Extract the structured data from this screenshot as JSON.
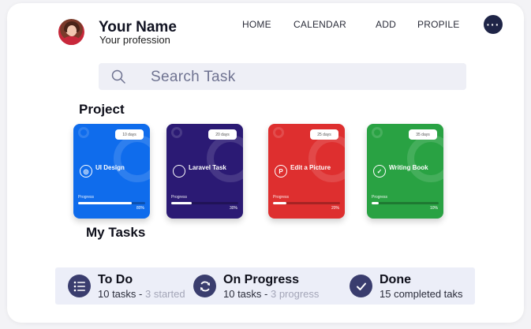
{
  "profile": {
    "name": "Your Name",
    "profession": "Your profession"
  },
  "nav": {
    "home": "HOME",
    "calendar": "CALENDAR",
    "add": "ADD",
    "profile": "PROPILE",
    "more_icon": "ellipsis-icon"
  },
  "search": {
    "placeholder": "Search Task"
  },
  "sections": {
    "project": "Project",
    "my_tasks": "My Tasks"
  },
  "projects": [
    {
      "name": "UI Design",
      "days": "10 days",
      "progress_label": "Progress",
      "progress": 0.8,
      "percent": "80%",
      "color": "#0f6cec",
      "icon": "ui-design-icon"
    },
    {
      "name": "Laravel Task",
      "days": "20 days",
      "progress_label": "Progress",
      "progress": 0.3,
      "percent": "30%",
      "color": "#2b1a74",
      "icon": "code-icon"
    },
    {
      "name": "Edit a Picture",
      "days": "25 days",
      "progress_label": "Progress",
      "progress": 0.2,
      "percent": "20%",
      "color": "#de2f2f",
      "icon": "pinterest-icon"
    },
    {
      "name": "Writing Book",
      "days": "35 days",
      "progress_label": "Progress",
      "progress": 0.1,
      "percent": "10%",
      "color": "#29a243",
      "icon": "check-icon"
    }
  ],
  "tasks": {
    "todo": {
      "title": "To Do",
      "count": "10 tasks -",
      "detail": "3 started",
      "icon": "list-icon"
    },
    "progress": {
      "title": "On Progress",
      "count": "10 tasks -",
      "detail": "3 progress",
      "icon": "refresh-icon"
    },
    "done": {
      "title": "Done",
      "count": "15 completed taks",
      "detail": "",
      "icon": "check-circle-icon"
    }
  },
  "colors": {
    "accent": "#1f2547",
    "task_icon": "#3a3d6e",
    "tasks_bg": "#eceef8"
  }
}
